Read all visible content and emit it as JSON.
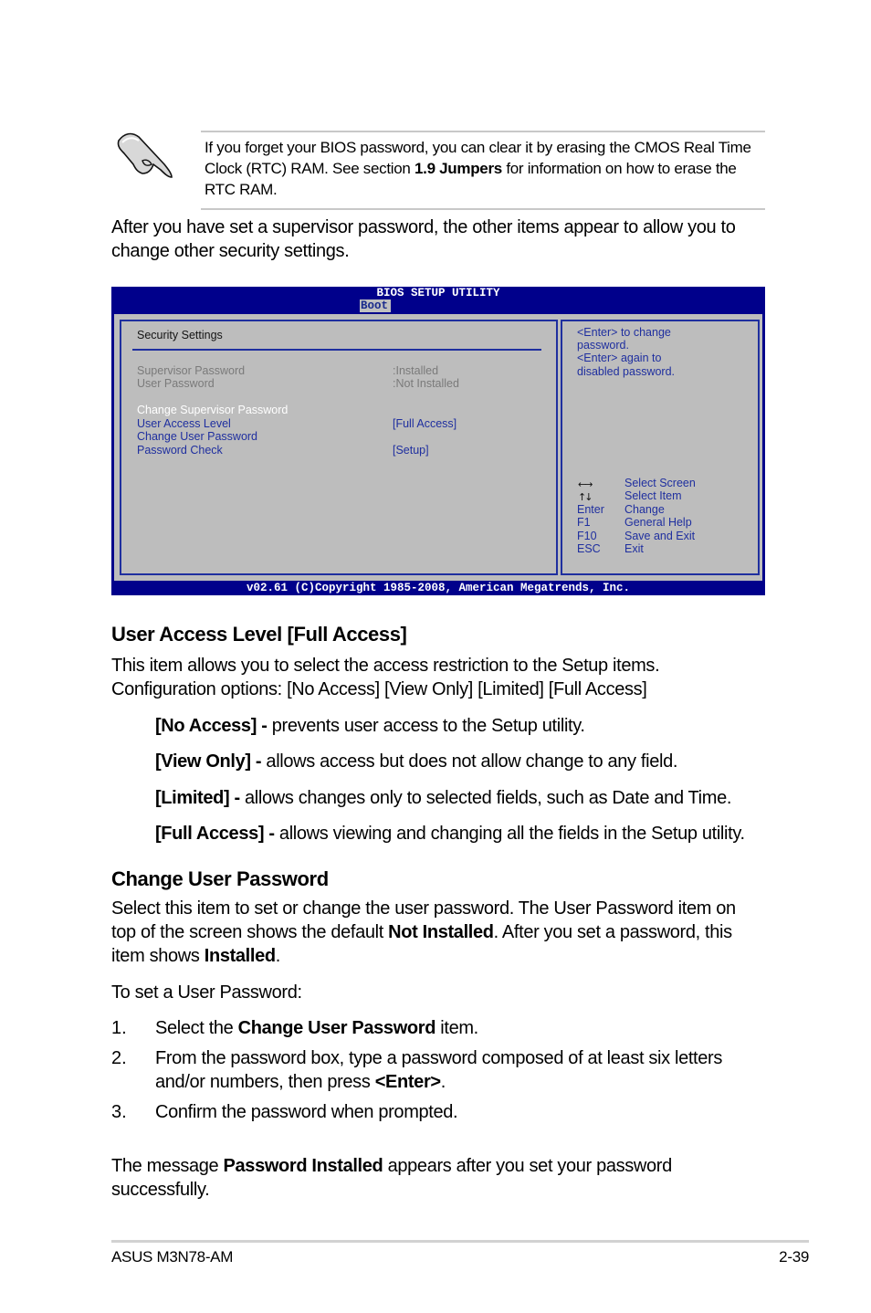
{
  "note": {
    "icon": "pointing-hand-icon",
    "text_before": "If you forget your BIOS password, you can clear it by erasing the CMOS Real Time Clock (RTC) RAM. See section ",
    "text_bold": "1.9 Jumpers",
    "text_after": " for information on how to erase the RTC RAM."
  },
  "intro": "After you have set a supervisor password, the other items appear to allow you to change other security settings.",
  "bios": {
    "title": "BIOS SETUP UTILITY",
    "active_tab": "Boot",
    "section_title": "Security Settings",
    "status_items": [
      {
        "label": "Supervisor Password",
        "value": ":Installed"
      },
      {
        "label": "User Password",
        "value": ":Not Installed"
      }
    ],
    "menu_items": [
      {
        "label": "Change Supervisor Password",
        "value": "",
        "selected": true
      },
      {
        "label": "User Access Level",
        "value": "[Full Access]",
        "selected": false
      },
      {
        "label": "Change User Password",
        "value": "",
        "selected": false
      },
      {
        "label": "Password Check",
        "value": "[Setup]",
        "selected": false
      }
    ],
    "help_lines": [
      "<Enter> to change",
      "password.",
      "<Enter> again to",
      "disabled password."
    ],
    "keys": [
      {
        "key": "left-right-arrows-icon",
        "key_text": "←→",
        "action": "Select Screen"
      },
      {
        "key": "up-down-arrows-icon",
        "key_text": "↑↓",
        "action": "Select Item"
      },
      {
        "key": "enter",
        "key_text": "Enter",
        "action": "Change"
      },
      {
        "key": "f1",
        "key_text": "F1",
        "action": "General Help"
      },
      {
        "key": "f10",
        "key_text": "F10",
        "action": "Save and Exit"
      },
      {
        "key": "esc",
        "key_text": "ESC",
        "action": "Exit"
      }
    ],
    "footer": "v02.61 (C)Copyright 1985-2008, American Megatrends, Inc.",
    "colors": {
      "frame": "#00008b",
      "panel": "#bdbdbd",
      "text_blue": "#1f2f9f"
    }
  },
  "section1": {
    "heading": "User Access Level [Full Access]",
    "desc_line1": "This item allows you to select the access restriction to the Setup items.",
    "desc_line2": "Configuration options: [No Access] [View Only] [Limited] [Full Access]",
    "options": [
      {
        "name": "[No Access] -",
        "desc": " prevents user access to the Setup utility."
      },
      {
        "name": "[View Only] -",
        "desc": " allows access but does not allow change to any field."
      },
      {
        "name": "[Limited] -",
        "desc": " allows changes only to selected fields, such as Date and Time."
      },
      {
        "name": "[Full Access] -",
        "desc": " allows viewing and changing all the fields in the Setup utility."
      }
    ]
  },
  "section2": {
    "heading": "Change User Password",
    "p1_a": "Select this item to set or change the user password. The User Password item on top of the screen shows the default ",
    "p1_b": "Not Installed",
    "p1_c": ". After you set a password, this item shows ",
    "p1_d": "Installed",
    "p1_e": ".",
    "p2": "To set a User Password:",
    "steps": [
      {
        "num": "1.",
        "a": "Select the ",
        "b": "Change User Password",
        "c": " item."
      },
      {
        "num": "2.",
        "a": "From the password box, type a password composed of at least six letters and/or numbers, then press ",
        "b": "<Enter>",
        "c": "."
      },
      {
        "num": "3.",
        "a": "Confirm the password when prompted.",
        "b": "",
        "c": ""
      }
    ],
    "p3_a": "The message ",
    "p3_b": "Password Installed",
    "p3_c": " appears after you set your password successfully."
  },
  "footer": {
    "left": "ASUS M3N78-AM",
    "right": "2-39"
  }
}
